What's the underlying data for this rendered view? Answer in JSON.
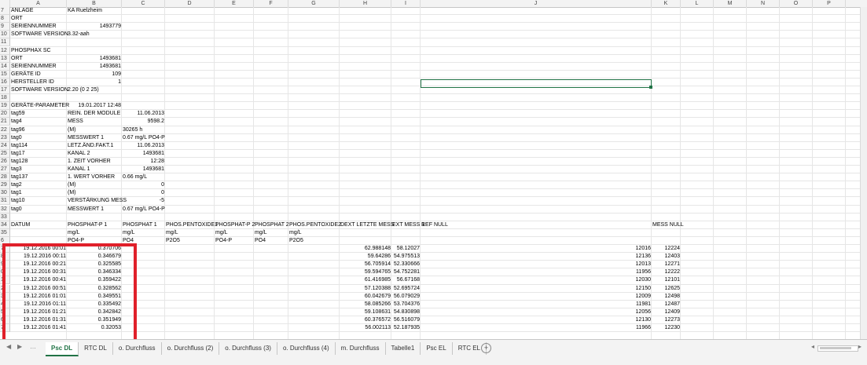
{
  "columns": [
    "A",
    "B",
    "C",
    "D",
    "E",
    "F",
    "G",
    "H",
    "I",
    "J",
    "K",
    "L",
    "M",
    "N",
    "O",
    "P"
  ],
  "rows": [
    {
      "n": "7",
      "a": "ANLAGE",
      "b": "KA Ruelzheim"
    },
    {
      "n": "8",
      "a": "ORT"
    },
    {
      "n": "9",
      "a": "SERIENNUMMER",
      "bR": "1493779"
    },
    {
      "n": "10",
      "a": "SOFTWARE VERSION",
      "b": "3.32-aah"
    },
    {
      "n": "11"
    },
    {
      "n": "12",
      "a": "PHOSPHAX SC"
    },
    {
      "n": "13",
      "a": "ORT",
      "bR": "1493681"
    },
    {
      "n": "14",
      "a": "SERIENNUMMER",
      "bR": "1493681"
    },
    {
      "n": "15",
      "a": "GERÄTE ID",
      "bR": "109"
    },
    {
      "n": "16",
      "a": "HERSTELLER ID",
      "bR": "1"
    },
    {
      "n": "17",
      "a": "SOFTWARE VERSION",
      "b": "2.20 (0 2 25)"
    },
    {
      "n": "18"
    },
    {
      "n": "19",
      "a": "GERÄTE-PARAMETER",
      "bR": "19.01.2017 12:48"
    },
    {
      "n": "20",
      "a": "tag59",
      "b": "REIN. DER MODULE",
      "cR": "11.06.2013"
    },
    {
      "n": "21",
      "a": "tag4",
      "b": "MESS",
      "cR": "9598.2"
    },
    {
      "n": "22",
      "a": "tag96",
      "b": "(M)",
      "c": "30265 h"
    },
    {
      "n": "23",
      "a": "tag0",
      "b": "MESSWERT 1",
      "c": "0.67 mg/L PO4-P"
    },
    {
      "n": "24",
      "a": "tag114",
      "b": "LETZ.ÄND.FAKT.1",
      "cR": "11.06.2013"
    },
    {
      "n": "25",
      "a": "tag17",
      "b": "KANAL 2",
      "cR": "1493681"
    },
    {
      "n": "26",
      "a": "tag128",
      "b": "1. ZEIT VORHER",
      "cR": "12:28"
    },
    {
      "n": "27",
      "a": "tag3",
      "b": "KANAL 1",
      "cR": "1493681"
    },
    {
      "n": "28",
      "a": "tag137",
      "b": "1. WERT VORHER",
      "c": "0.66 mg/L"
    },
    {
      "n": "29",
      "a": "tag2",
      "b": "(M)",
      "cR": "0"
    },
    {
      "n": "30",
      "a": "tag1",
      "b": "(M)",
      "cR": "0"
    },
    {
      "n": "31",
      "a": "tag10",
      "b": "VERSTÄRKUNG MESS",
      "cR": "-5"
    },
    {
      "n": "32",
      "a": "tag0",
      "b": "MESSWERT 1",
      "c": "0.67 mg/L PO4-P"
    },
    {
      "n": "33"
    },
    {
      "n": "34",
      "a": "DATUM",
      "b": "PHOSPHAT-P 1",
      "c": "PHOSPHAT 1",
      "d": "PHOS.PENTOXIDE1",
      "e": "PHOSPHAT-P 2",
      "f": "PHOSPHAT 2",
      "g": "PHOS.PENTOXIDE2",
      "h": "DEXT LETZTE MESS",
      "i": "EXT MESS 1",
      "j": "REF NULL",
      "k": "MESS NULL"
    },
    {
      "n": "35",
      "b": "mg/L",
      "c": "mg/L",
      "d": "mg/L",
      "e": "mg/L",
      "f": "mg/L",
      "g": "mg/L"
    },
    {
      "n": "6",
      "b": "PO4-P",
      "c": "PO4",
      "d": "P2O5",
      "e": "PO4-P",
      "f": "PO4",
      "g": "P2O5"
    },
    {
      "n": "7",
      "aR": "19.12.2016 00:01",
      "bR": "0.370706",
      "hR": "62.988148",
      "iR": "58.12027",
      "jR": "12016",
      "kR": "12224"
    },
    {
      "n": "8",
      "aR": "19.12.2016 00:11",
      "bR": "0.346679",
      "hR": "59.64286",
      "iR": "54.975513",
      "jR": "12136",
      "kR": "12403"
    },
    {
      "n": "9",
      "aR": "19.12.2016 00:21",
      "bR": "0.325585",
      "hR": "56.705914",
      "iR": "52.330666",
      "jR": "12013",
      "kR": "12271"
    },
    {
      "n": "0",
      "aR": "19.12.2016 00:31",
      "bR": "0.346334",
      "hR": "59.594765",
      "iR": "54.752281",
      "jR": "11956",
      "kR": "12222"
    },
    {
      "n": "1",
      "aR": "19.12.2016 00:41",
      "bR": "0.359422",
      "hR": "61.416985",
      "iR": "56.67168",
      "jR": "12030",
      "kR": "12101"
    },
    {
      "n": "2",
      "aR": "19.12.2016 00:51",
      "bR": "0.328562",
      "hR": "57.120388",
      "iR": "52.695724",
      "jR": "12150",
      "kR": "12625"
    },
    {
      "n": "3",
      "aR": "19.12.2016 01:01",
      "bR": "0.349551",
      "hR": "60.042679",
      "iR": "56.079029",
      "jR": "12009",
      "kR": "12498"
    },
    {
      "n": "4",
      "aR": "19.12.2016 01:11",
      "bR": "0.335492",
      "hR": "58.085266",
      "iR": "53.704376",
      "jR": "11981",
      "kR": "12487"
    },
    {
      "n": "5",
      "aR": "19.12.2016 01:21",
      "bR": "0.342842",
      "hR": "59.108631",
      "iR": "54.830898",
      "jR": "12056",
      "kR": "12409"
    },
    {
      "n": "6",
      "aR": "19.12.2016 01:31",
      "bR": "0.351949",
      "hR": "60.376572",
      "iR": "56.516079",
      "jR": "12130",
      "kR": "12273"
    },
    {
      "n": "7",
      "aR": "19.12.2016 01:41",
      "bR": "0.32053",
      "hR": "56.002113",
      "iR": "52.187935",
      "jR": "11966",
      "kR": "12230"
    }
  ],
  "tabs": [
    "Psc DL",
    "RTC DL",
    "o. Durchfluss",
    "o. Durchfluss (2)",
    "o. Durchfluss (3)",
    "o. Durchfluss (4)",
    "m. Durchfluss",
    "Tabelle1",
    "Psc EL",
    "RTC EL"
  ],
  "active_tab": "Psc DL",
  "highlight_color": "#e0202a",
  "accent_color": "#217346"
}
